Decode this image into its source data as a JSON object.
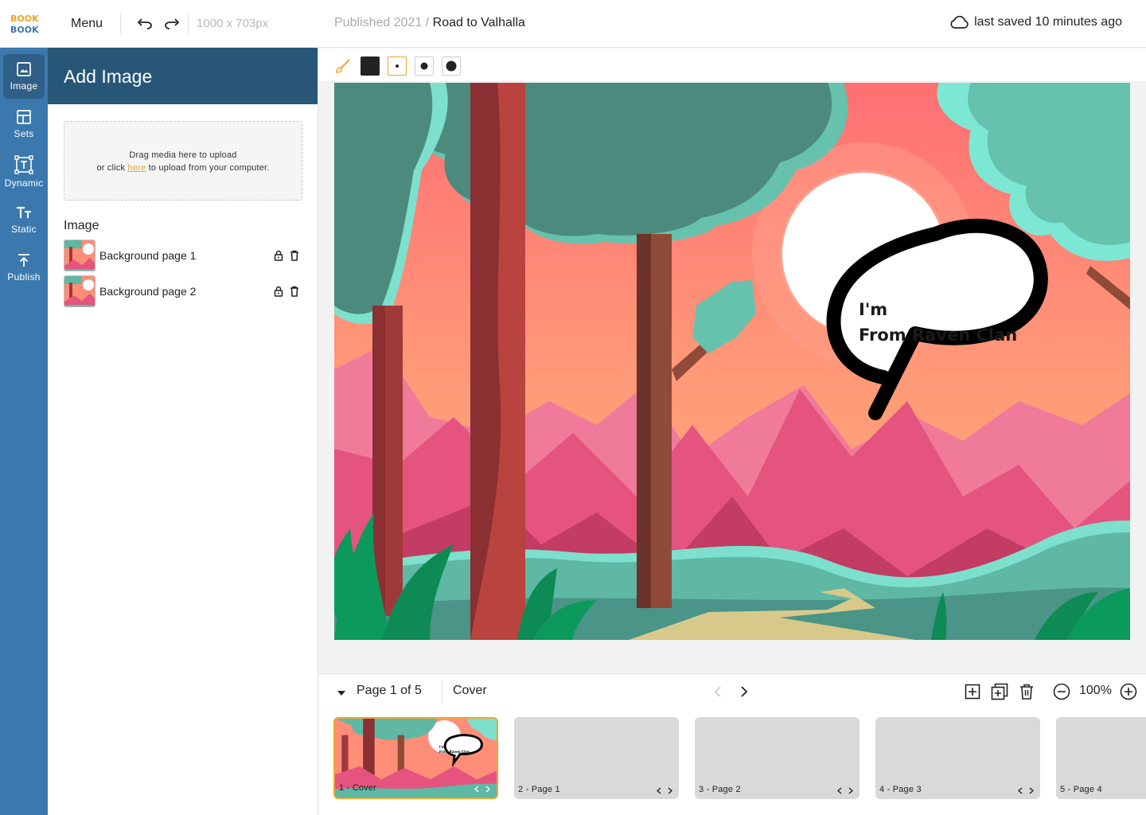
{
  "header": {
    "menu_label": "Menu",
    "canvas_size": "1000 x 703px",
    "breadcrumb_parent": "Published 2021",
    "breadcrumb_sep": "/",
    "document_title": "Road to Valhalla",
    "saved_status": "last saved 10 minutes ago"
  },
  "sidebar": {
    "items": [
      {
        "label": "Image",
        "icon": "image-icon"
      },
      {
        "label": "Sets",
        "icon": "sets-icon"
      },
      {
        "label": "Dynamic",
        "icon": "dynamic-text-icon"
      },
      {
        "label": "Static",
        "icon": "static-text-icon"
      },
      {
        "label": "Publish",
        "icon": "publish-icon"
      }
    ]
  },
  "panel": {
    "title": "Add Image",
    "dropzone_line1": "Drag media here to upload",
    "dropzone_prefix": "or click ",
    "dropzone_link": "here",
    "dropzone_suffix": " to upload from your computer.",
    "section_title": "Image",
    "images": [
      {
        "name": "Background page 1"
      },
      {
        "name": "Background page 2"
      }
    ]
  },
  "canvas": {
    "bubble_line1": "I'm",
    "bubble_line2": "From Raven Clan"
  },
  "pages": {
    "indicator": "Page 1 of 5",
    "current_name": "Cover",
    "zoom": "100%",
    "thumbs": [
      {
        "label": "1 - Cover",
        "active": true
      },
      {
        "label": "2 - Page 1",
        "active": false
      },
      {
        "label": "3 - Page 2",
        "active": false
      },
      {
        "label": "4 - Page 3",
        "active": false
      },
      {
        "label": "5 - Page 4",
        "active": false
      }
    ]
  },
  "colors": {
    "accent": "#f0a429",
    "rail": "#3a78ad",
    "panel_header": "#275677",
    "sky": "#ff8e78",
    "foliage": "#5fb8a4",
    "mountain": "#e4547f"
  }
}
